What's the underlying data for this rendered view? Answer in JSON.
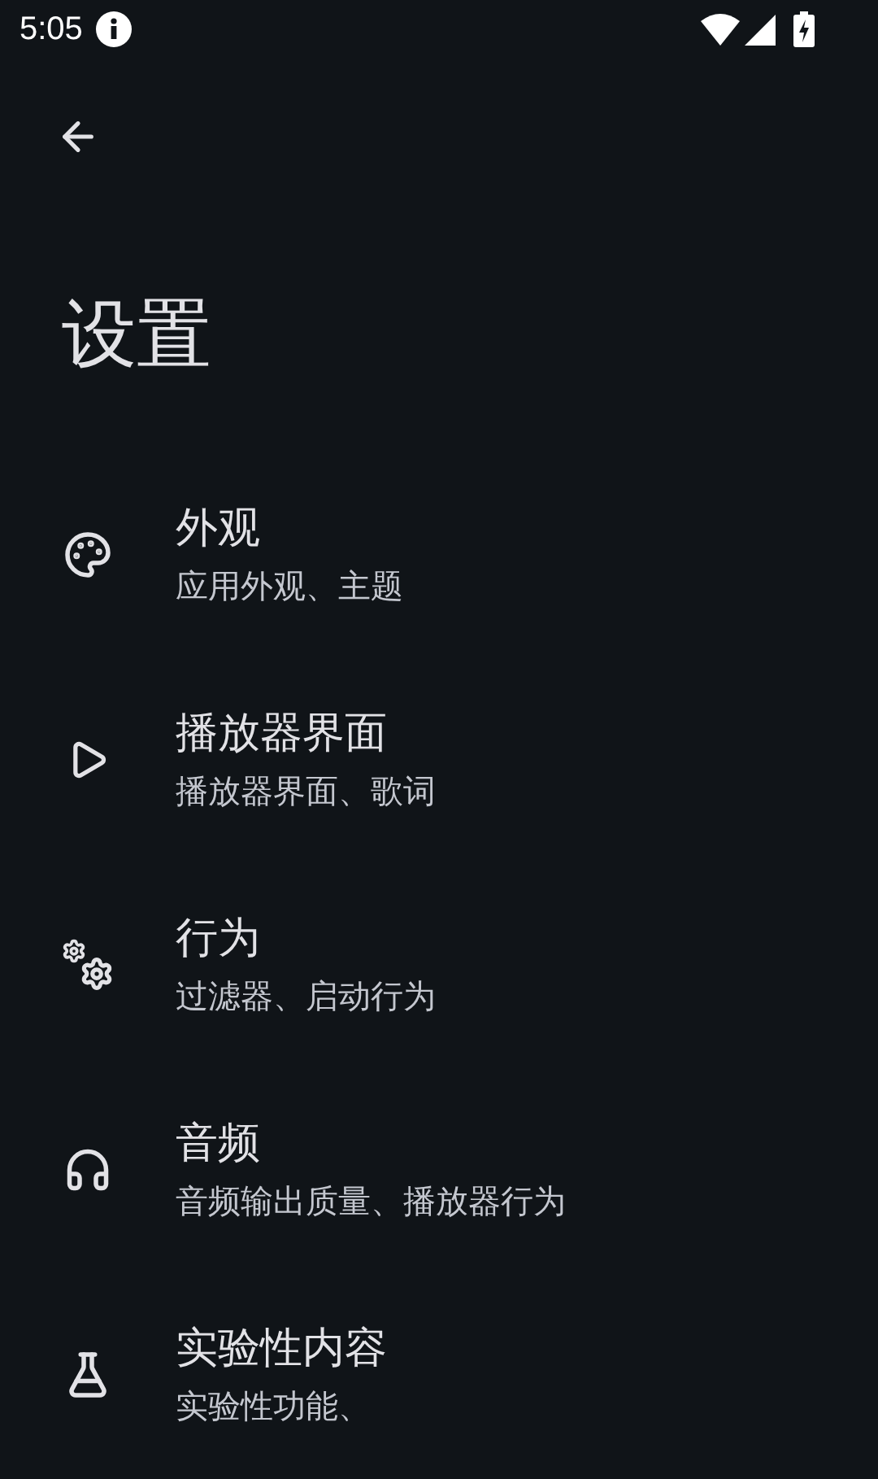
{
  "status_bar": {
    "time": "5:05"
  },
  "title": "设置",
  "items": [
    {
      "title": "外观",
      "subtitle": "应用外观、主题"
    },
    {
      "title": "播放器界面",
      "subtitle": "播放器界面、歌词"
    },
    {
      "title": "行为",
      "subtitle": "过滤器、启动行为"
    },
    {
      "title": "音频",
      "subtitle": "音频输出质量、播放器行为"
    },
    {
      "title": "实验性内容",
      "subtitle": "实验性功能、"
    }
  ]
}
